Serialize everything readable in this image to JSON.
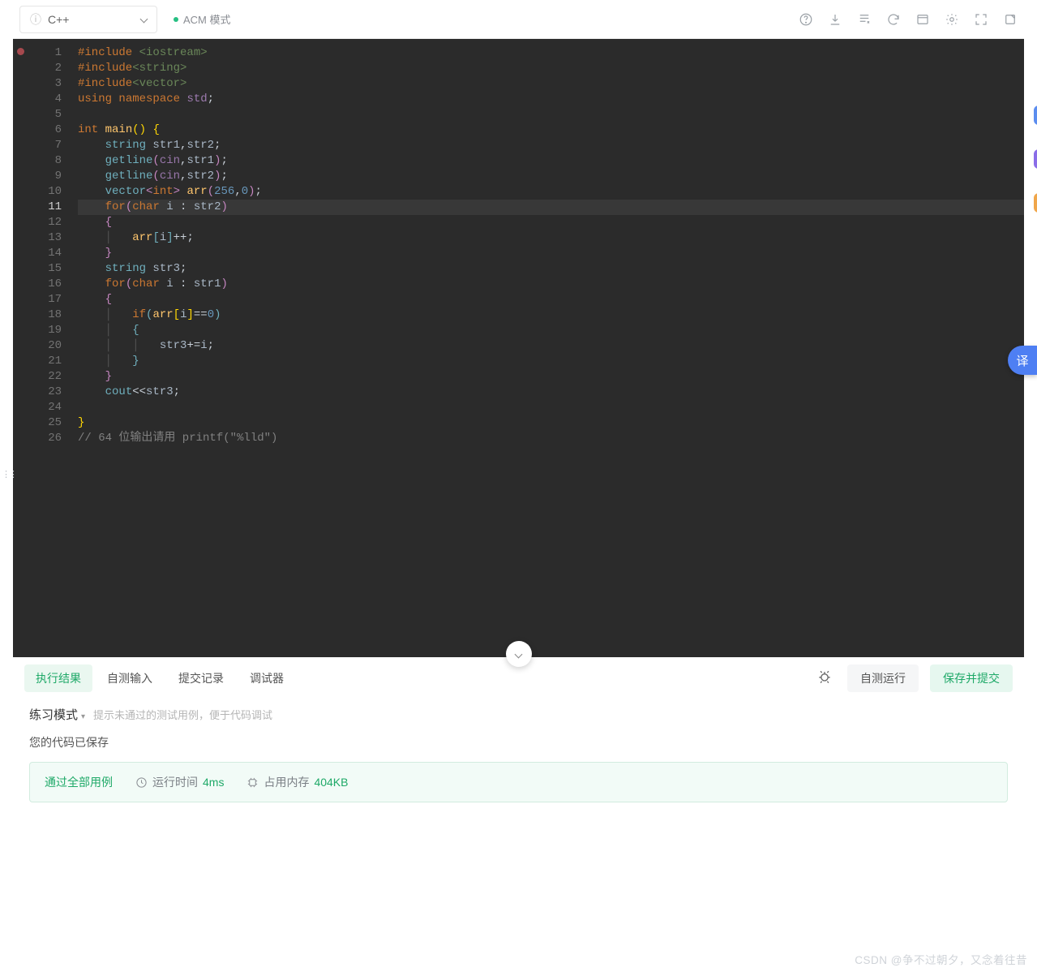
{
  "toolbar": {
    "language": "C++",
    "mode_label": "ACM 模式",
    "icons": [
      "help",
      "download",
      "notes",
      "refresh",
      "layout",
      "settings",
      "fullscreen",
      "new-window"
    ]
  },
  "editor": {
    "highlighted_line": 11,
    "lines": [
      {
        "n": 1,
        "tokens": [
          [
            "pp",
            "#include "
          ],
          [
            "header",
            "<iostream>"
          ]
        ]
      },
      {
        "n": 2,
        "tokens": [
          [
            "pp",
            "#include"
          ],
          [
            "header",
            "<string>"
          ]
        ]
      },
      {
        "n": 3,
        "tokens": [
          [
            "pp",
            "#include"
          ],
          [
            "header",
            "<vector>"
          ]
        ]
      },
      {
        "n": 4,
        "tokens": [
          [
            "pp",
            "using "
          ],
          [
            "pp",
            "namespace "
          ],
          [
            "std",
            "std"
          ],
          [
            "op",
            ";"
          ]
        ]
      },
      {
        "n": 5,
        "tokens": []
      },
      {
        "n": 6,
        "tokens": [
          [
            "kw",
            "int "
          ],
          [
            "name",
            "main"
          ],
          [
            "paren-y",
            "() "
          ],
          [
            "paren-y",
            "{"
          ]
        ]
      },
      {
        "n": 7,
        "tokens": [
          [
            "op",
            "    "
          ],
          [
            "builtin",
            "string "
          ],
          [
            "var",
            "str1"
          ],
          [
            "op",
            ","
          ],
          [
            "var",
            "str2"
          ],
          [
            "op",
            ";"
          ]
        ]
      },
      {
        "n": 8,
        "tokens": [
          [
            "op",
            "    "
          ],
          [
            "builtin",
            "getline"
          ],
          [
            "paren-p",
            "("
          ],
          [
            "cin",
            "cin"
          ],
          [
            "op",
            ","
          ],
          [
            "var",
            "str1"
          ],
          [
            "paren-p",
            ")"
          ],
          [
            "op",
            ";"
          ]
        ]
      },
      {
        "n": 9,
        "tokens": [
          [
            "op",
            "    "
          ],
          [
            "builtin",
            "getline"
          ],
          [
            "paren-p",
            "("
          ],
          [
            "cin",
            "cin"
          ],
          [
            "op",
            ","
          ],
          [
            "var",
            "str2"
          ],
          [
            "paren-p",
            ")"
          ],
          [
            "op",
            ";"
          ]
        ]
      },
      {
        "n": 10,
        "tokens": [
          [
            "op",
            "    "
          ],
          [
            "builtin",
            "vector"
          ],
          [
            "paren-p",
            "<"
          ],
          [
            "kw",
            "int"
          ],
          [
            "paren-p",
            "> "
          ],
          [
            "name",
            "arr"
          ],
          [
            "paren-p",
            "("
          ],
          [
            "num",
            "256"
          ],
          [
            "op",
            ","
          ],
          [
            "num",
            "0"
          ],
          [
            "paren-p",
            ")"
          ],
          [
            "op",
            ";"
          ]
        ]
      },
      {
        "n": 11,
        "tokens": [
          [
            "op",
            "    "
          ],
          [
            "kw",
            "for"
          ],
          [
            "paren-p",
            "("
          ],
          [
            "kw",
            "char "
          ],
          [
            "var",
            "i"
          ],
          [
            "op",
            " : "
          ],
          [
            "var",
            "str2"
          ],
          [
            "paren-p",
            ")"
          ]
        ]
      },
      {
        "n": 12,
        "tokens": [
          [
            "op",
            "    "
          ],
          [
            "paren-p",
            "{"
          ]
        ]
      },
      {
        "n": 13,
        "tokens": [
          [
            "guide",
            "    │   "
          ],
          [
            "name",
            "arr"
          ],
          [
            "paren-b",
            "["
          ],
          [
            "var",
            "i"
          ],
          [
            "paren-b",
            "]"
          ],
          [
            "op",
            "++;"
          ]
        ]
      },
      {
        "n": 14,
        "tokens": [
          [
            "op",
            "    "
          ],
          [
            "paren-p",
            "}"
          ]
        ]
      },
      {
        "n": 15,
        "tokens": [
          [
            "op",
            "    "
          ],
          [
            "builtin",
            "string "
          ],
          [
            "var",
            "str3"
          ],
          [
            "op",
            ";"
          ]
        ]
      },
      {
        "n": 16,
        "tokens": [
          [
            "op",
            "    "
          ],
          [
            "kw",
            "for"
          ],
          [
            "paren-p",
            "("
          ],
          [
            "kw",
            "char "
          ],
          [
            "var",
            "i"
          ],
          [
            "op",
            " : "
          ],
          [
            "var",
            "str1"
          ],
          [
            "paren-p",
            ")"
          ]
        ]
      },
      {
        "n": 17,
        "tokens": [
          [
            "op",
            "    "
          ],
          [
            "paren-p",
            "{"
          ]
        ]
      },
      {
        "n": 18,
        "tokens": [
          [
            "guide",
            "    │   "
          ],
          [
            "kw",
            "if"
          ],
          [
            "paren-b",
            "("
          ],
          [
            "name",
            "arr"
          ],
          [
            "paren-y",
            "["
          ],
          [
            "var",
            "i"
          ],
          [
            "paren-y",
            "]"
          ],
          [
            "op",
            "=="
          ],
          [
            "num",
            "0"
          ],
          [
            "paren-b",
            ")"
          ]
        ]
      },
      {
        "n": 19,
        "tokens": [
          [
            "guide",
            "    │   "
          ],
          [
            "paren-b",
            "{"
          ]
        ]
      },
      {
        "n": 20,
        "tokens": [
          [
            "guide",
            "    │   │   "
          ],
          [
            "var",
            "str3"
          ],
          [
            "op",
            "+="
          ],
          [
            "var",
            "i"
          ],
          [
            "op",
            ";"
          ]
        ]
      },
      {
        "n": 21,
        "tokens": [
          [
            "guide",
            "    │   "
          ],
          [
            "paren-b",
            "}"
          ]
        ]
      },
      {
        "n": 22,
        "tokens": [
          [
            "op",
            "    "
          ],
          [
            "paren-p",
            "}"
          ]
        ]
      },
      {
        "n": 23,
        "tokens": [
          [
            "op",
            "    "
          ],
          [
            "builtin",
            "cout"
          ],
          [
            "op",
            "<<"
          ],
          [
            "var",
            "str3"
          ],
          [
            "op",
            ";"
          ]
        ]
      },
      {
        "n": 24,
        "tokens": []
      },
      {
        "n": 25,
        "tokens": [
          [
            "paren-y",
            "}"
          ]
        ]
      },
      {
        "n": 26,
        "tokens": [
          [
            "comment",
            "// 64 位输出请用 printf(\"%lld\")"
          ]
        ]
      }
    ]
  },
  "result_tabs": [
    "执行结果",
    "自测输入",
    "提交记录",
    "调试器"
  ],
  "active_result_tab": 0,
  "buttons": {
    "self_test": "自测运行",
    "save_submit": "保存并提交"
  },
  "practice": {
    "title": "练习模式",
    "hint": "提示未通过的测试用例，便于代码调试"
  },
  "saved_message": "您的代码已保存",
  "pass": {
    "label": "通过全部用例",
    "runtime_label": "运行时间",
    "runtime_value": "4ms",
    "memory_label": "占用内存",
    "memory_value": "404KB"
  },
  "translate_label": "译",
  "watermark": "CSDN @争不过朝夕，又念着往昔"
}
